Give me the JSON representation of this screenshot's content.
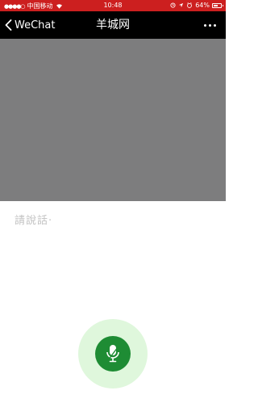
{
  "status_bar": {
    "carrier": "中国移动",
    "time": "10:48",
    "battery_percent": "64%",
    "battery_level": 0.64,
    "background_color": "#cc1f1f"
  },
  "nav": {
    "back_label": "WeChat",
    "title": "羊城网",
    "background_color": "#000000"
  },
  "voice": {
    "prompt": "請說話·",
    "mic_color": "#1e8c34",
    "halo_color": "#dff7dc"
  },
  "icons": [
    "signal-icon",
    "wifi-icon",
    "location-icon",
    "alarm-icon",
    "battery-icon",
    "back-chevron-icon",
    "more-icon",
    "microphone-icon"
  ]
}
